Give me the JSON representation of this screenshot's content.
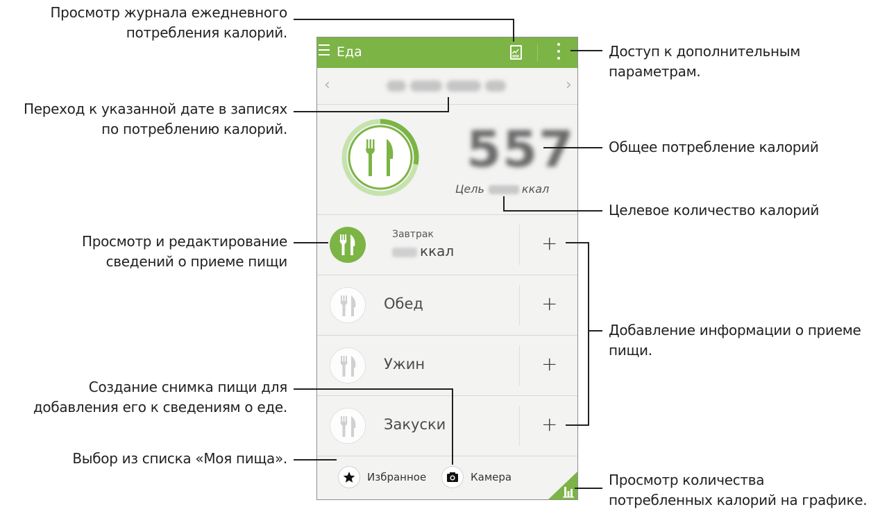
{
  "app": {
    "title": "Еда",
    "date_label": "чт, 5 Июн 2014",
    "total_kcal": "557",
    "goal_prefix": "Цель",
    "goal_unit": "ккал",
    "nav_prev": "‹",
    "nav_next": "›",
    "progress_fraction": 0.28,
    "accent_color": "#7cb445",
    "meals": [
      {
        "label": "Завтрак",
        "kcal_unit": "ккал",
        "active": true
      },
      {
        "label": "Обед",
        "active": false
      },
      {
        "label": "Ужин",
        "active": false
      },
      {
        "label": "Закуски",
        "active": false
      }
    ],
    "add_symbol": "+",
    "bottom": {
      "favorites_label": "Избранное",
      "camera_label": "Камера"
    }
  },
  "callouts": {
    "journal": "Просмотр журнала ежедневного\nпотребления калорий.",
    "date": "Переход к указанной дате в записях\nпо потреблению калорий.",
    "meal_details": "Просмотр и редактирование\nсведений о приеме пищи",
    "photo": "Создание снимка пищи для\nдобавления его к сведениям о еде.",
    "my_food": "Выбор из списка «Моя пища».",
    "more_options": "Доступ к дополнительным\nпараметрам.",
    "total": "Общее потребление калорий",
    "goal": "Целевое количество калорий",
    "add_meal": "Добавление информации о приеме\nпищи.",
    "graph": "Просмотр количества\nпотребленных калорий на графике."
  }
}
